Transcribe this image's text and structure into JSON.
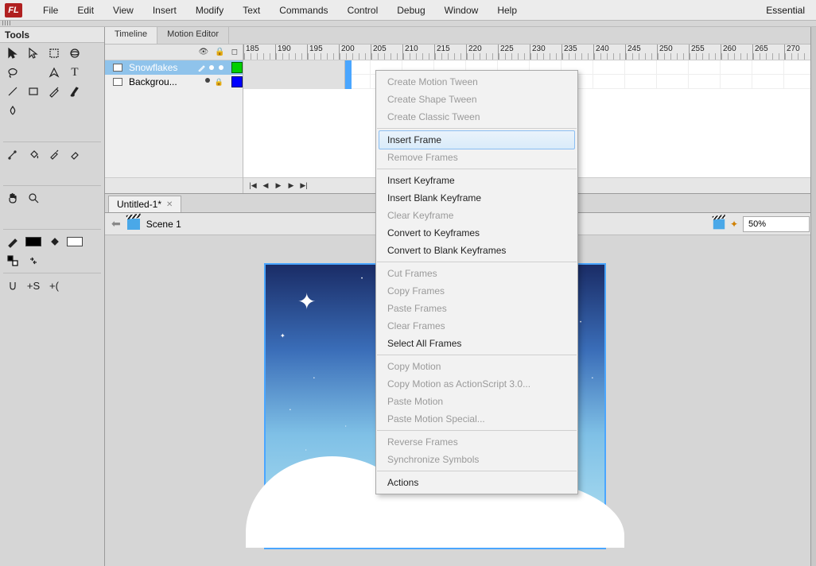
{
  "app_logo_text": "FL",
  "menubar": {
    "items": [
      "File",
      "Edit",
      "View",
      "Insert",
      "Modify",
      "Text",
      "Commands",
      "Control",
      "Debug",
      "Window",
      "Help"
    ],
    "essential": "Essential"
  },
  "tools": {
    "title": "Tools"
  },
  "timeline": {
    "tabs": [
      "Timeline",
      "Motion Editor"
    ],
    "ruler_start": 185,
    "ruler_step": 5,
    "ruler_count": 18,
    "layers": [
      {
        "name": "Snowflakes",
        "color": "green",
        "selected": true,
        "locked": false
      },
      {
        "name": "Backgrou...",
        "color": "blue",
        "selected": false,
        "locked": true
      }
    ]
  },
  "doc": {
    "tab": "Untitled-1*",
    "scene": "Scene 1",
    "zoom": "50%"
  },
  "context_menu": {
    "groups": [
      [
        {
          "t": "Create Motion Tween",
          "d": true
        },
        {
          "t": "Create Shape Tween",
          "d": true
        },
        {
          "t": "Create Classic Tween",
          "d": true
        }
      ],
      [
        {
          "t": "Insert Frame",
          "hover": true
        },
        {
          "t": "Remove Frames",
          "d": true
        }
      ],
      [
        {
          "t": "Insert Keyframe"
        },
        {
          "t": "Insert Blank Keyframe"
        },
        {
          "t": "Clear Keyframe",
          "d": true
        },
        {
          "t": "Convert to Keyframes"
        },
        {
          "t": "Convert to Blank Keyframes"
        }
      ],
      [
        {
          "t": "Cut Frames",
          "d": true
        },
        {
          "t": "Copy Frames",
          "d": true
        },
        {
          "t": "Paste Frames",
          "d": true
        },
        {
          "t": "Clear Frames",
          "d": true
        },
        {
          "t": "Select All Frames"
        }
      ],
      [
        {
          "t": "Copy Motion",
          "d": true
        },
        {
          "t": "Copy Motion as ActionScript 3.0...",
          "d": true
        },
        {
          "t": "Paste Motion",
          "d": true
        },
        {
          "t": "Paste Motion Special...",
          "d": true
        }
      ],
      [
        {
          "t": "Reverse Frames",
          "d": true
        },
        {
          "t": "Synchronize Symbols",
          "d": true
        }
      ],
      [
        {
          "t": "Actions"
        }
      ]
    ]
  }
}
